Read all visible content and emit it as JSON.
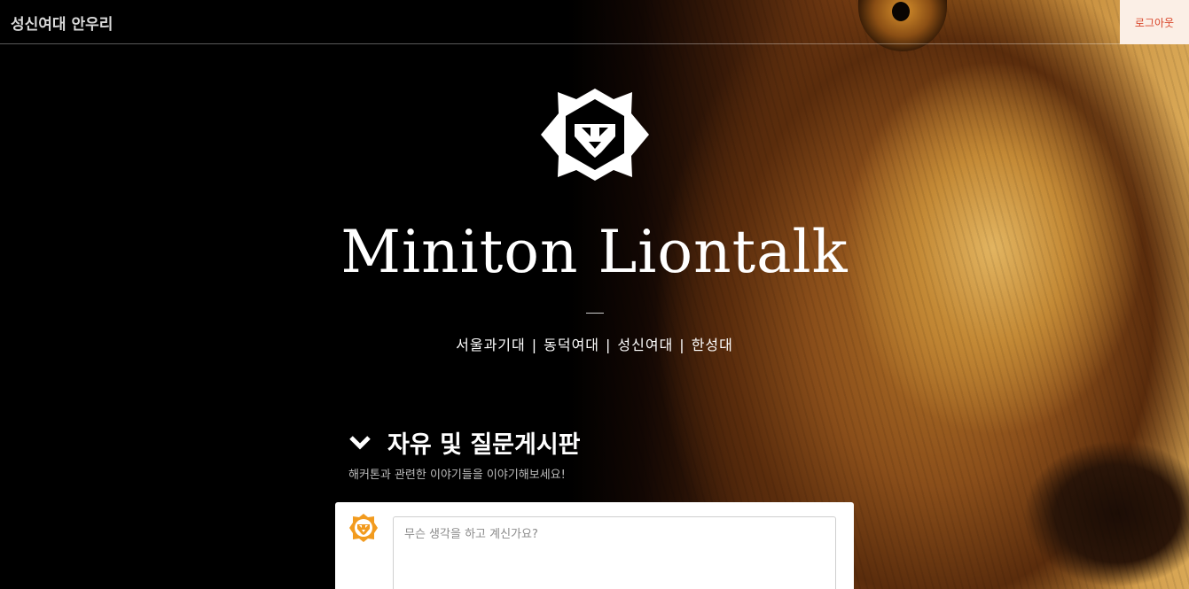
{
  "header": {
    "site_name": "성신여대 안우리",
    "logout_label": "로그아웃"
  },
  "hero": {
    "title": "Miniton Liontalk",
    "schools": [
      "서울과기대",
      "동덕여대",
      "성신여대",
      "한성대"
    ],
    "separator": "|"
  },
  "board": {
    "title": "자유 및 질문게시판",
    "subtitle": "해커톤과 관련한 이야기들을 이야기해보세요!",
    "post_placeholder": "무슨 생각을 하고 계신가요?"
  },
  "colors": {
    "accent_orange": "#f29b1f",
    "logout_text": "#d9472b",
    "logout_bg": "#fbefe6"
  },
  "icons": {
    "logo": "lion-logo-icon",
    "board_toggle": "chevron-down-icon",
    "avatar": "lion-avatar-icon"
  }
}
